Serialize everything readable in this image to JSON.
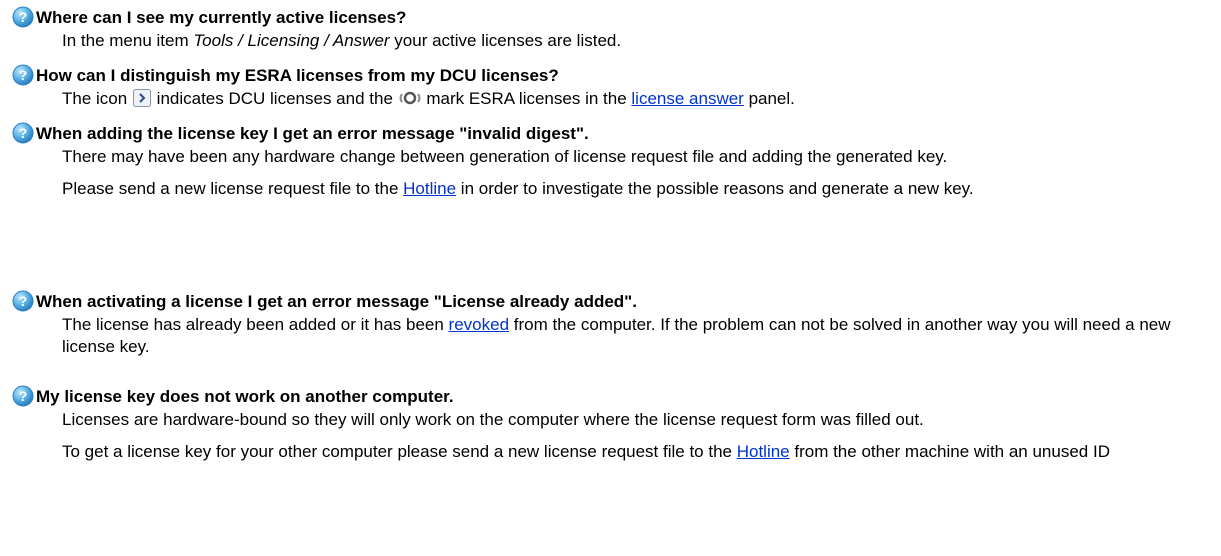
{
  "faq": [
    {
      "icon": "help-question-icon",
      "question": "Where can I see my currently active licenses?",
      "answer": {
        "prefix": "In the menu item ",
        "menu_path": "Tools / Licensing / Answer",
        "suffix": " your active licenses are listed."
      }
    },
    {
      "icon": "help-question-icon",
      "question": "How can I distinguish my ESRA licenses from my DCU licenses?",
      "answer": {
        "part1": "The icon ",
        "dcu_icon": "dcu-license-icon",
        "part2": " indicates DCU licenses and the ",
        "esra_icon": "esra-license-icon",
        "part3": " mark ESRA licenses in the ",
        "link": "license answer",
        "part4": " panel."
      }
    },
    {
      "icon": "help-question-icon",
      "question": "When adding the license key I get an error message \"invalid digest\".",
      "answer": {
        "para1": "There may have been any hardware change between generation of license request file and adding the generated key.",
        "para2_prefix": "Please send a new license request file to the ",
        "para2_link": "Hotline",
        "para2_suffix": " in order to investigate the possible reasons and generate a new key."
      }
    },
    {
      "icon": "help-question-icon",
      "question": "When activating a license I get an error message \"License already added\".",
      "answer": {
        "prefix": "The license has already been added or it has been ",
        "link": "revoked",
        "suffix": " from the computer. If the problem can not be solved in another way you will need a new license key."
      }
    },
    {
      "icon": "help-question-icon",
      "question": "My license key does not work on another computer.",
      "answer": {
        "para1": "Licenses are hardware-bound so they will only work on the computer where the license request form was filled out.",
        "para2_prefix": "To get a license key for your other computer please send a new license request file to the ",
        "para2_link": "Hotline",
        "para2_suffix": " from the other machine with an unused ID"
      }
    }
  ],
  "colors": {
    "icon_fill": "#5ab4e8",
    "icon_border": "#2d7fc0",
    "link": "#0033cc",
    "text": "#000000"
  }
}
